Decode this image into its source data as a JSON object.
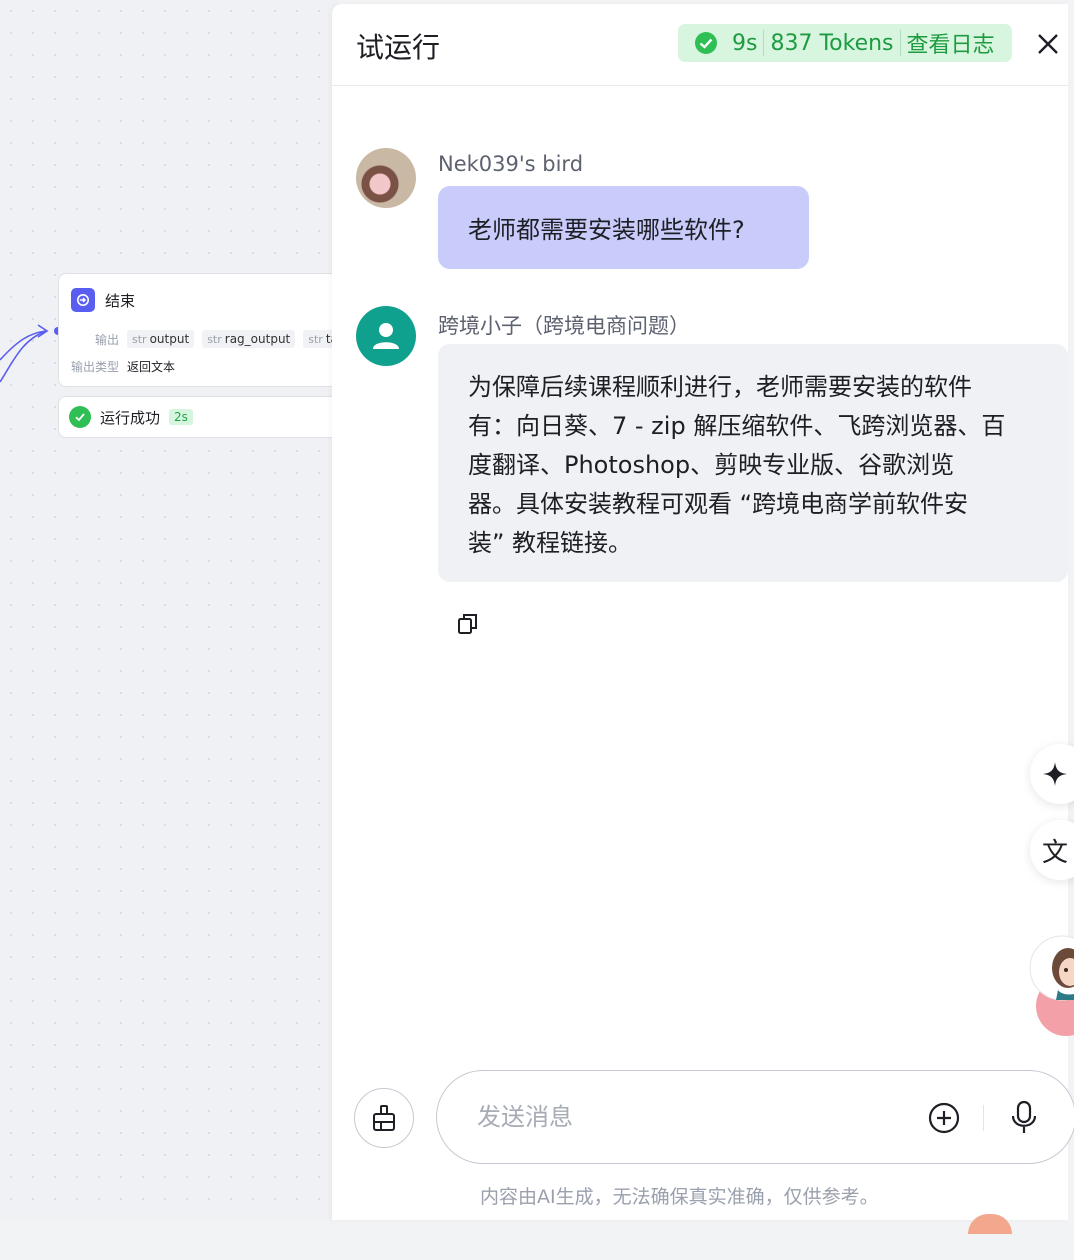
{
  "canvas": {
    "end_node": {
      "title": "结束",
      "output_label": "输出",
      "outputs": [
        {
          "type": "str",
          "name": "output"
        },
        {
          "type": "str",
          "name": "rag_output"
        },
        {
          "type": "str",
          "name": "tal"
        }
      ],
      "output_type_label": "输出类型",
      "output_type_value": "返回文本"
    },
    "run_status": {
      "label": "运行成功",
      "duration": "2s"
    }
  },
  "panel": {
    "title": "试运行",
    "run_info": {
      "time": "9s",
      "tokens": "837 Tokens",
      "log_link": "查看日志"
    },
    "messages": [
      {
        "sender": "Nek039's bird",
        "role": "user",
        "text": "老师都需要安装哪些软件?"
      },
      {
        "sender": "跨境小子（跨境电商问题）",
        "role": "bot",
        "lines": [
          "为保障后续课程顺利进行，老师需要安装的软件",
          "有：向日葵、7 - zip 解压缩软件、飞跨浏览器、百",
          "度翻译、Photoshop、剪映专业版、谷歌浏览",
          "器。具体安装教程可观看 “跨境电商学前软件安",
          "装” 教程链接。"
        ]
      }
    ],
    "input": {
      "placeholder": "发送消息",
      "value": ""
    },
    "disclaimer": "内容由AI生成，无法确保真实准确，仅供参考。",
    "side_buttons": {
      "translate_glyph": "文"
    },
    "colors": {
      "accent": "#5a5ef0",
      "success": "#2fbf54",
      "user_bubble": "#c9ccfb",
      "bot_avatar": "#0fa08e"
    },
    "icons": [
      "check-circle-icon",
      "close-icon",
      "copy-icon",
      "sparkle-icon",
      "translate-icon",
      "brush-icon",
      "plus-circle-icon",
      "mic-icon",
      "end-node-icon"
    ]
  }
}
